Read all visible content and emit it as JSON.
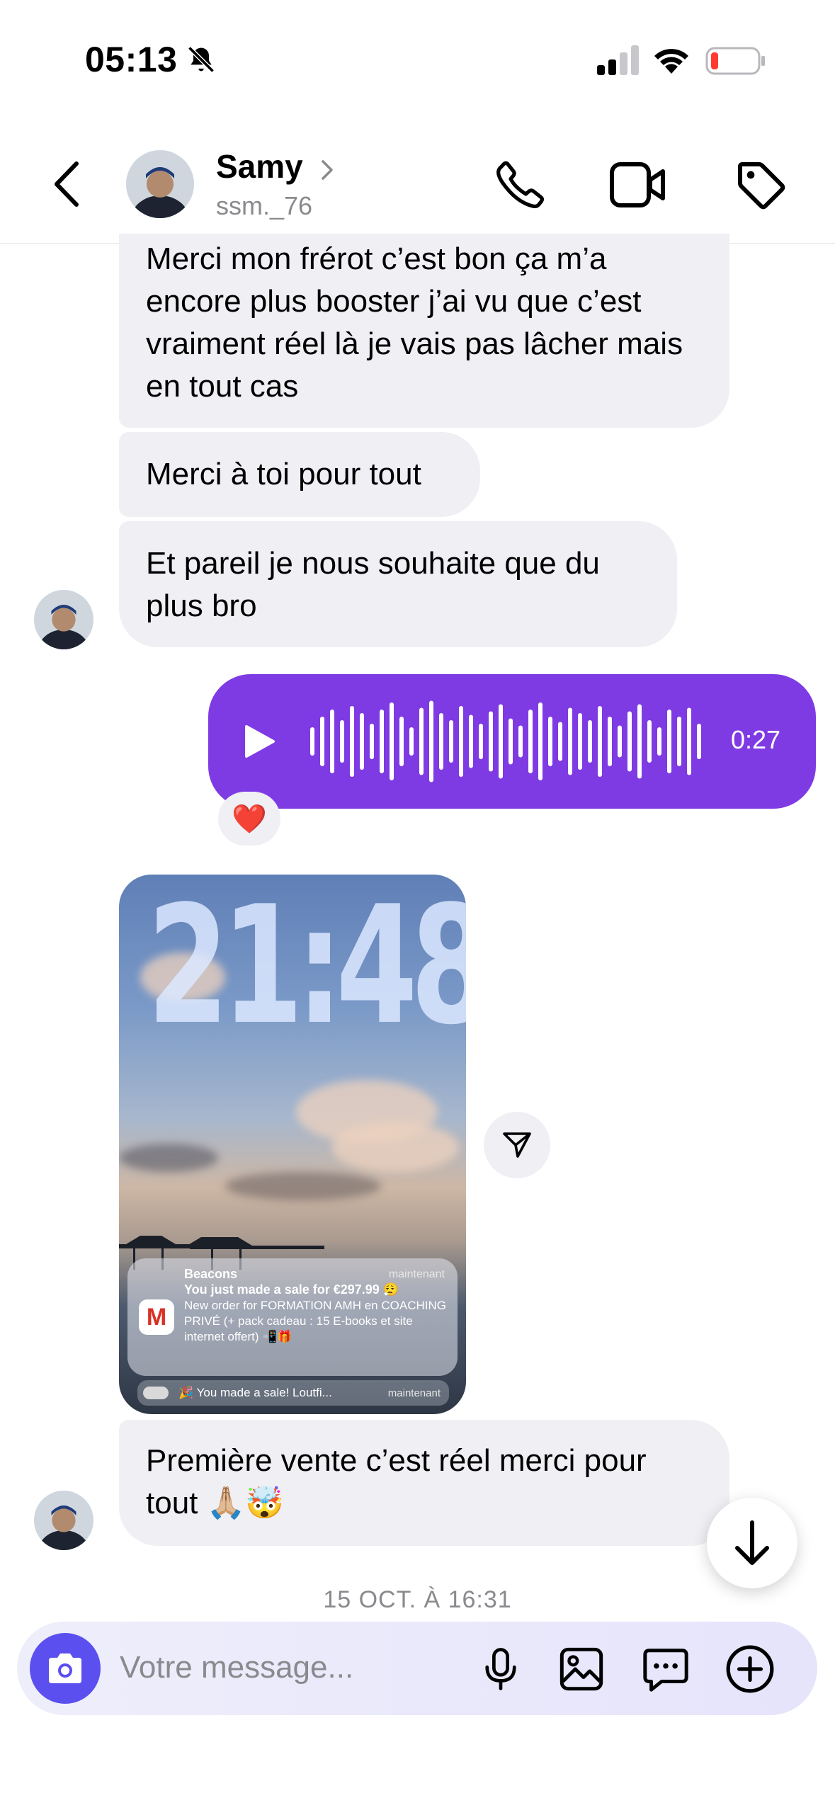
{
  "status_bar": {
    "time": "05:13",
    "icons": [
      "bell-slash-icon",
      "signal-icon",
      "wifi-icon",
      "battery-low-icon"
    ]
  },
  "header": {
    "name": "Samy",
    "username": "ssm._76",
    "icons": [
      "back-chevron-icon",
      "phone-icon",
      "video-icon",
      "tag-icon"
    ]
  },
  "messages": [
    {
      "text": "Merci mon frérot c’est bon ça m’a encore plus booster j’ai vu que c’est vraiment réel là je vais pas lâcher mais en tout cas"
    },
    {
      "text": "Merci à toi pour tout"
    },
    {
      "text": "Et pareil je nous souhaite que du plus bro"
    }
  ],
  "voice_message": {
    "duration": "0:27",
    "reaction": "❤️"
  },
  "screenshot": {
    "clock": "21:48",
    "notification": {
      "app": "Beacons",
      "time": "maintenant",
      "title": "You just made a sale for €297.99 😮‍💨",
      "body": "New order for FORMATION AMH en COACHING PRIVÉ (+ pack cadeau : 15 E-books et site internet offert) 📲🎁"
    },
    "notification2": {
      "text": "🎉 You made a sale! Loutfi...",
      "time": "maintenant"
    }
  },
  "last_message": {
    "text": "Première vente c’est réel merci pour tout 🙏🏼🤯"
  },
  "date_separator": "15 OCT. À 16:31",
  "composer": {
    "placeholder": "Votre message..."
  },
  "colors": {
    "accent": "#7f3be3",
    "camera": "#5b4ff0",
    "bubble": "#efeff4"
  }
}
